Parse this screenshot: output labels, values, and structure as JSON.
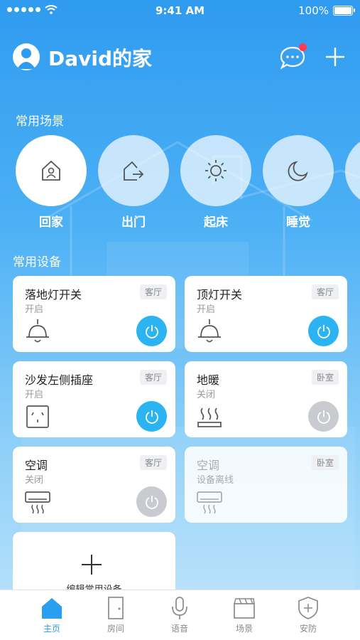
{
  "status_bar": {
    "time": "9:41 AM",
    "battery": "100%"
  },
  "header": {
    "title": "David的家"
  },
  "scenes": {
    "section_title": "常用场景",
    "items": [
      {
        "label": "回家",
        "icon": "home-person-icon",
        "active": true
      },
      {
        "label": "出门",
        "icon": "leave-home-icon",
        "active": false
      },
      {
        "label": "起床",
        "icon": "sun-icon",
        "active": false
      },
      {
        "label": "睡觉",
        "icon": "moon-icon",
        "active": false
      }
    ]
  },
  "devices": {
    "section_title": "常用设备",
    "items": [
      {
        "name": "落地灯开关",
        "status": "开启",
        "room": "客厅",
        "icon": "lamp-icon",
        "power": "on"
      },
      {
        "name": "顶灯开关",
        "status": "开启",
        "room": "客厅",
        "icon": "lamp-icon",
        "power": "on"
      },
      {
        "name": "沙发左侧插座",
        "status": "开启",
        "room": "客厅",
        "icon": "socket-icon",
        "power": "on"
      },
      {
        "name": "地暖",
        "status": "关闭",
        "room": "卧室",
        "icon": "floor-heating-icon",
        "power": "off"
      },
      {
        "name": "空调",
        "status": "关闭",
        "room": "客厅",
        "icon": "air-conditioner-icon",
        "power": "off"
      },
      {
        "name": "空调",
        "status": "设备离线",
        "room": "卧室",
        "icon": "air-conditioner-icon",
        "power": "offline"
      }
    ],
    "edit_label": "编辑常用设备"
  },
  "tabbar": {
    "items": [
      {
        "label": "主页",
        "icon": "home-icon",
        "active": true
      },
      {
        "label": "房间",
        "icon": "door-icon",
        "active": false
      },
      {
        "label": "语音",
        "icon": "microphone-icon",
        "active": false
      },
      {
        "label": "场景",
        "icon": "clapperboard-icon",
        "active": false
      },
      {
        "label": "安防",
        "icon": "shield-icon",
        "active": false
      }
    ]
  },
  "colors": {
    "accent": "#2cb3f2",
    "badge": "#ff3b50",
    "power_off": "#c9cbd1"
  }
}
